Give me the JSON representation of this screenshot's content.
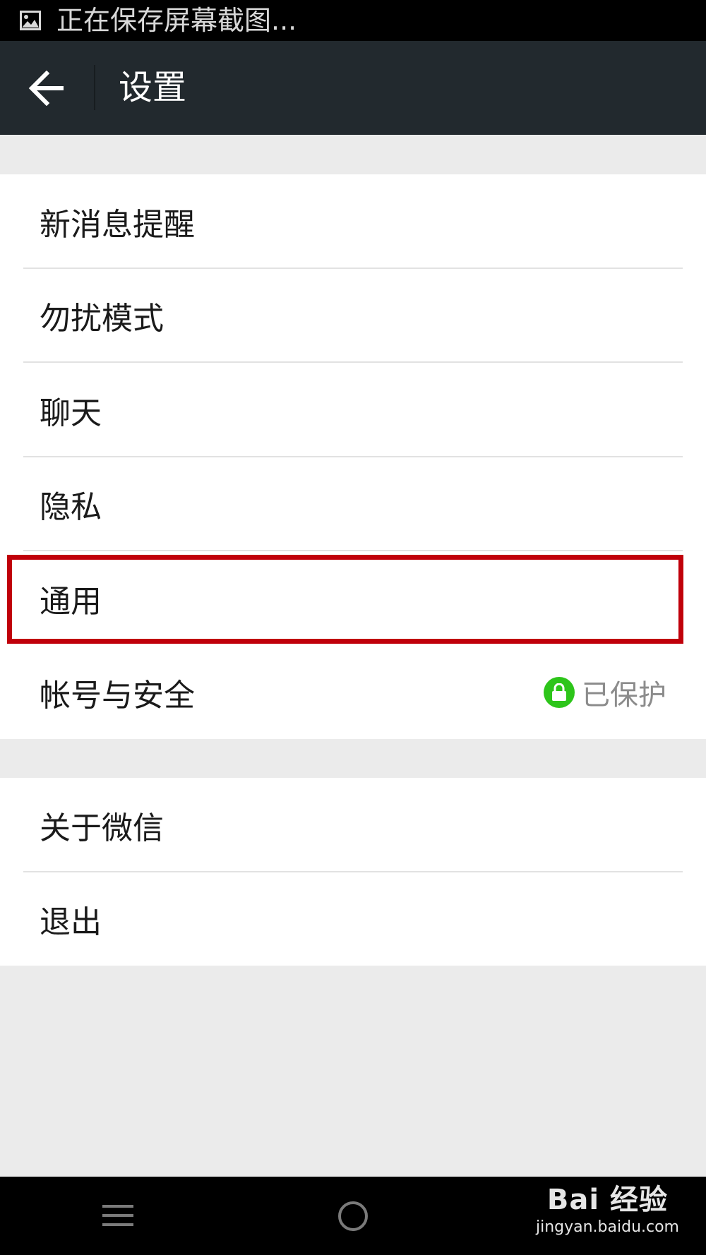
{
  "status_bar": {
    "text": "正在保存屏幕截图..."
  },
  "header": {
    "title": "设置"
  },
  "settings": {
    "group1": [
      {
        "label": "新消息提醒"
      },
      {
        "label": "勿扰模式"
      },
      {
        "label": "聊天"
      },
      {
        "label": "隐私"
      },
      {
        "label": "通用"
      },
      {
        "label": "帐号与安全",
        "status": "已保护"
      }
    ],
    "group2": [
      {
        "label": "关于微信"
      },
      {
        "label": "退出"
      }
    ]
  },
  "watermark": {
    "line1": "Bai 经验",
    "line2": "jingyan.baidu.com"
  },
  "colors": {
    "header_bg": "#22292e",
    "highlight_border": "#c0000a",
    "lock_badge": "#2dc51a",
    "page_bg": "#ebebeb"
  },
  "icons": {
    "status": "image-icon",
    "back": "arrow-left-icon",
    "lock": "lock-icon",
    "menu": "menu-icon",
    "home": "home-circle-icon"
  }
}
